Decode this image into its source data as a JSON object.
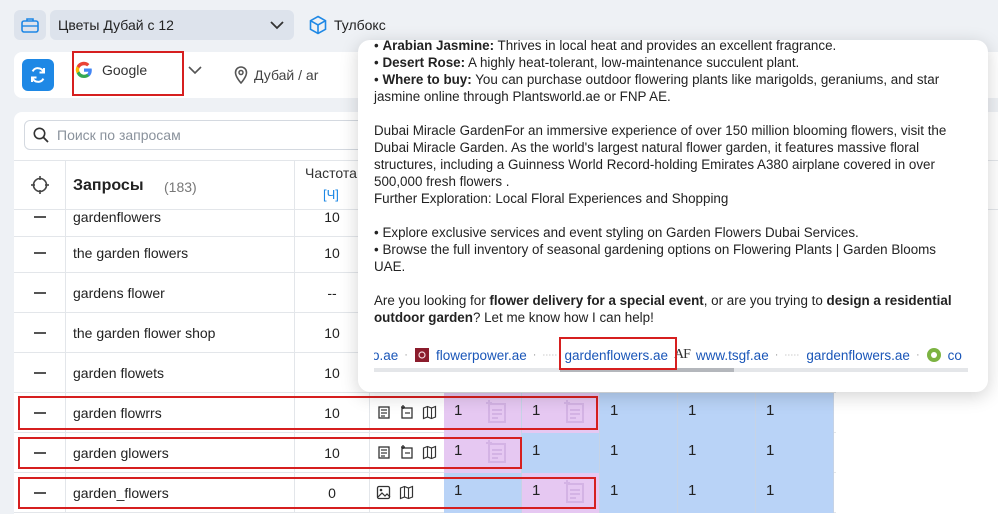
{
  "topbar": {
    "project_name": "Цветы Дубай с 12",
    "toolbox_label": "Тулбокс"
  },
  "filters": {
    "engine": "Google",
    "region": "Дубай / ar"
  },
  "search": {
    "placeholder": "Поиск по запросам"
  },
  "table": {
    "queries_header": "Запросы",
    "queries_count": "(183)",
    "freq_header": "Частота",
    "freq_unit": "[Ч]",
    "rows": [
      {
        "query": "gardenflowers",
        "freq": "10",
        "cells": []
      },
      {
        "query": "the garden flowers",
        "freq": "10",
        "cells": []
      },
      {
        "query": "gardens flower",
        "freq": "--",
        "cells": []
      },
      {
        "query": "the garden flower shop",
        "freq": "10",
        "cells": []
      },
      {
        "query": "garden flowets",
        "freq": "10",
        "cells": []
      },
      {
        "query": "garden flowrrs",
        "freq": "10",
        "cells": [
          "1",
          "1",
          "1",
          "1",
          "1"
        ]
      },
      {
        "query": "garden glowers",
        "freq": "10",
        "cells": [
          "1",
          "1",
          "1",
          "1",
          "1"
        ]
      },
      {
        "query": "garden_flowers",
        "freq": "0",
        "cells": [
          "1",
          "1",
          "1",
          "1",
          "1"
        ]
      }
    ]
  },
  "popup": {
    "line1_bold": "Arabian Jasmine:",
    "line1_rest": " Thrives in local heat and provides an excellent fragrance.",
    "line2_bold": "Desert Rose:",
    "line2_rest": " A highly heat-tolerant, low-maintenance succulent plant.",
    "line3_bold": "Where to buy:",
    "line3_rest": " You can purchase outdoor flowering plants like marigolds, geraniums, and star jasmine online through Plantsworld.ae or FNP AE.",
    "para2": "Dubai Miracle GardenFor an immersive experience of over 150 million blooming flowers, visit the Dubai Miracle Garden. As the world's largest natural flower garden, it features massive floral structures, including a Guinness World Record-holding Emirates A380 airplane covered in over 500,000 fresh flowers .",
    "para2b": "Further Exploration: Local Floral Experiences and Shopping",
    "bullet4": "Explore exclusive services and event styling on Garden Flowers Dubai Services.",
    "bullet5": "Browse the full inventory of seasonal gardening options on Flowering Plants | Garden Blooms UAE.",
    "q_pre": "Are you looking for ",
    "q_b1": "flower delivery for a special event",
    "q_mid": ", or are you trying to ",
    "q_b2": "design a residential outdoor garden",
    "q_post": "? Let me know how I can help!",
    "bullet_char": "•",
    "sources": [
      "o.ae",
      "flowerpower.ae",
      "gardenflowers.ae",
      "www.tsgf.ae",
      "gardenflowers.ae",
      "co"
    ],
    "source_sep": "·",
    "af_logo": "AF"
  },
  "colors": {
    "accent": "#1e88e5",
    "highlight": "#d61f1f",
    "pink_cell": "#e6c8f2",
    "blue_cell": "#b9d3f7"
  }
}
